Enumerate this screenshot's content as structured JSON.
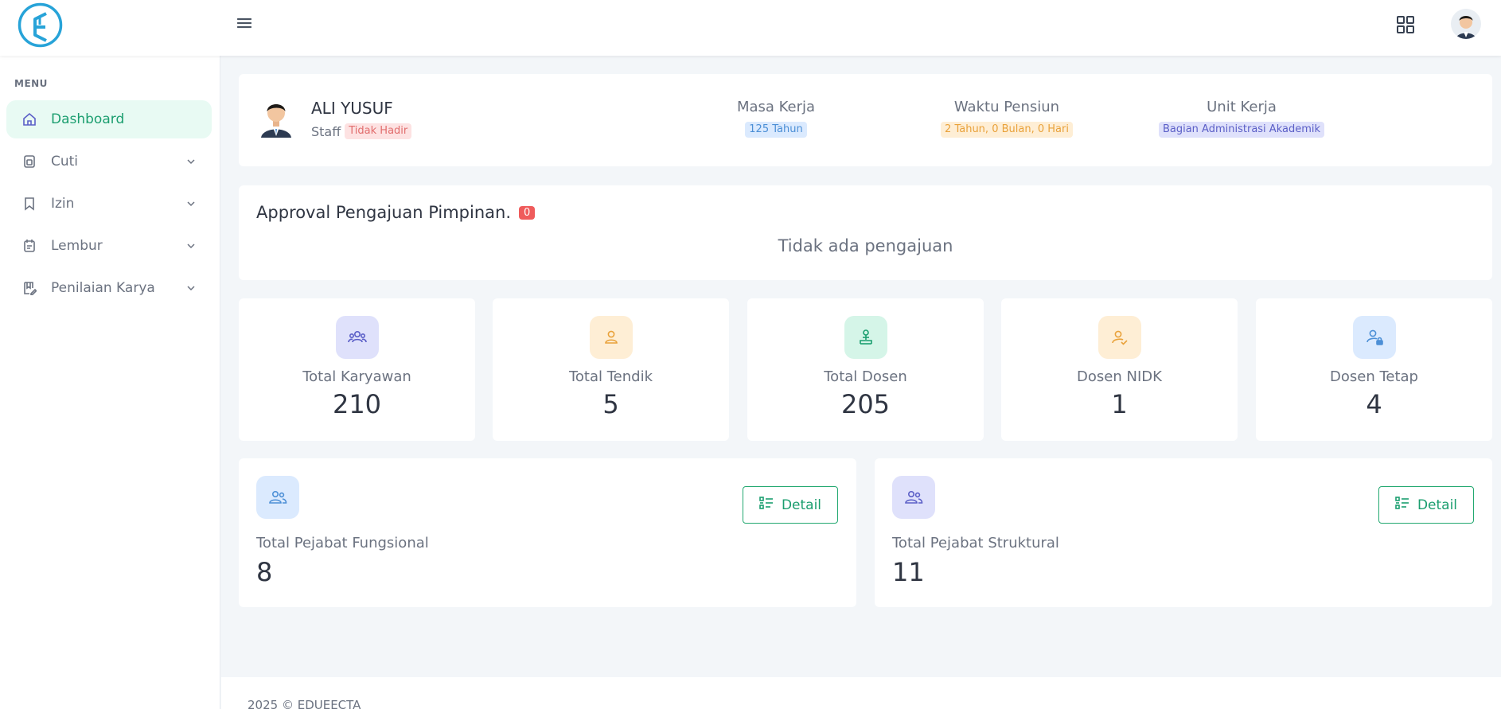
{
  "topbar": {
    "logo_icon": "edueecta-logo-icon",
    "menu_icon": "hamburger-icon",
    "apps_icon": "grid-icon",
    "avatar_icon": "user-avatar"
  },
  "sidebar": {
    "menu_title": "MENU",
    "items": [
      {
        "label": "Dashboard",
        "icon": "home-icon",
        "active": true
      },
      {
        "label": "Cuti",
        "icon": "calendar-icon",
        "has_submenu": true
      },
      {
        "label": "Izin",
        "icon": "bookmark-icon",
        "has_submenu": true
      },
      {
        "label": "Lembur",
        "icon": "clipboard-icon",
        "has_submenu": true
      },
      {
        "label": "Penilaian Karya",
        "icon": "book-edit-icon",
        "has_submenu": true
      }
    ]
  },
  "profile": {
    "name": "ALI YUSUF",
    "role": "Staff",
    "status": "Tidak Hadir",
    "masa_kerja_label": "Masa Kerja",
    "masa_kerja_value": "125 Tahun",
    "pensiun_label": "Waktu Pensiun",
    "pensiun_value": "2 Tahun, 0 Bulan, 0 Hari",
    "unit_label": "Unit Kerja",
    "unit_value": "Bagian Administrasi Akademik"
  },
  "approval": {
    "title": "Approval Pengajuan Pimpinan.",
    "count": "0",
    "empty": "Tidak ada pengajuan"
  },
  "stats": [
    {
      "label": "Total Karyawan",
      "value": "210",
      "icon": "users-icon",
      "color": "#5b5fc7",
      "bg": "#dfe1fb"
    },
    {
      "label": "Total Tendik",
      "value": "5",
      "icon": "user-icon",
      "color": "#e9a23b",
      "bg": "#feeed5"
    },
    {
      "label": "Total Dosen",
      "value": "205",
      "icon": "teacher-icon",
      "color": "#1b9e6f",
      "bg": "#d5f5e8"
    },
    {
      "label": "Dosen NIDK",
      "value": "1",
      "icon": "user-check-icon",
      "color": "#e9a23b",
      "bg": "#feeed5"
    },
    {
      "label": "Dosen Tetap",
      "value": "4",
      "icon": "user-lock-icon",
      "color": "#4c8fd6",
      "bg": "#dbeafe"
    }
  ],
  "pejabat": [
    {
      "label": "Total Pejabat Fungsional",
      "value": "8",
      "icon": "users-icon",
      "color": "#4c8fd6",
      "bg": "#dbeafe",
      "button": "Detail"
    },
    {
      "label": "Total Pejabat Struktural",
      "value": "11",
      "icon": "users-icon",
      "color": "#5b5fc7",
      "bg": "#dfe1fb",
      "button": "Detail"
    }
  ],
  "footer": {
    "text": "2025 © EDUEECTA"
  }
}
